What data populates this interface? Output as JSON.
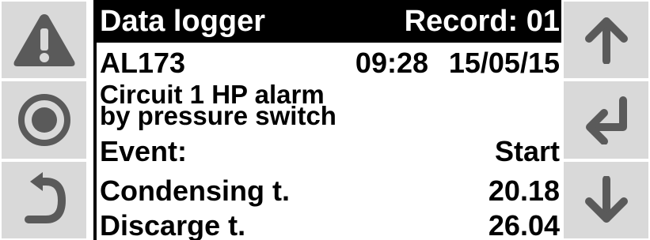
{
  "screen": {
    "title": "Data logger",
    "record": "Record: 01",
    "alarm_code": "AL173",
    "time": "09:28",
    "date": "15/05/15",
    "description_line1": "Circuit 1 HP alarm",
    "description_line2": "by pressure switch",
    "event_label": "Event:",
    "event_value": "Start",
    "rows": [
      {
        "label": "Condensing t.",
        "value": "20.18"
      },
      {
        "label": "Discarge t.",
        "value": "26.04"
      }
    ]
  },
  "keys": {
    "left": [
      "alarm-icon",
      "program-icon",
      "escape-icon"
    ],
    "right": [
      "up-arrow-icon",
      "enter-icon",
      "down-arrow-icon"
    ]
  },
  "colors": {
    "key_bg": "#d9d9d9",
    "icon": "#5a5a5a",
    "screen_bg": "#ffffff",
    "screen_fg": "#000000"
  }
}
